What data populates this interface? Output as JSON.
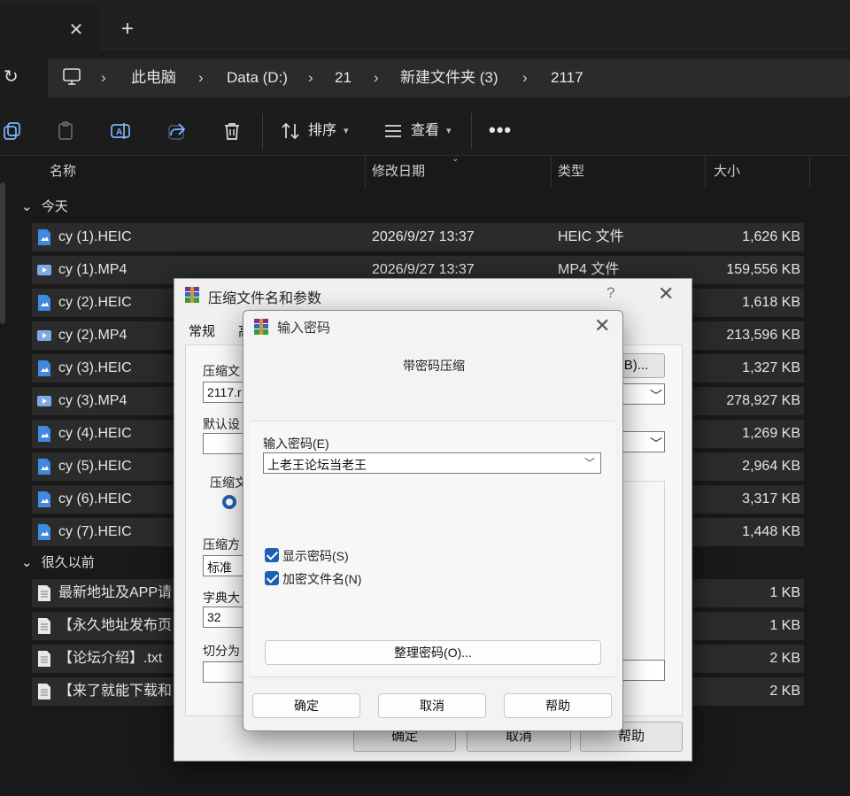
{
  "tabbar": {
    "close_icon": "close-icon",
    "new_tab_icon": "plus-icon",
    "close_glyph": "✕",
    "new_glyph": "+"
  },
  "address": {
    "crumbs": [
      "此电脑",
      "Data (D:)",
      "21",
      "新建文件夹 (3)",
      "2117"
    ],
    "separator": "›"
  },
  "toolbar": {
    "sort_label": "排序",
    "view_label": "查看",
    "more_glyph": "•••"
  },
  "columns": {
    "name": "名称",
    "modified": "修改日期",
    "type": "类型",
    "size": "大小"
  },
  "groups": {
    "today": "今天",
    "long_ago": "很久以前"
  },
  "group_chevron": "⌄",
  "files_today": [
    {
      "name": "cy (1).HEIC",
      "date": "2026/9/27 13:37",
      "type": "HEIC 文件",
      "size": "1,626 KB",
      "kind": "image"
    },
    {
      "name": "cy (1).MP4",
      "date": "2026/9/27 13:37",
      "type": "MP4 文件",
      "size": "159,556 KB",
      "kind": "video"
    },
    {
      "name": "cy (2).HEIC",
      "date": "",
      "type": "",
      "size": "1,618 KB",
      "kind": "image"
    },
    {
      "name": "cy (2).MP4",
      "date": "",
      "type": "",
      "size": "213,596 KB",
      "kind": "video"
    },
    {
      "name": "cy (3).HEIC",
      "date": "",
      "type": "",
      "size": "1,327 KB",
      "kind": "image"
    },
    {
      "name": "cy (3).MP4",
      "date": "",
      "type": "",
      "size": "278,927 KB",
      "kind": "video"
    },
    {
      "name": "cy (4).HEIC",
      "date": "",
      "type": "",
      "size": "1,269 KB",
      "kind": "image"
    },
    {
      "name": "cy (5).HEIC",
      "date": "",
      "type": "",
      "size": "2,964 KB",
      "kind": "image"
    },
    {
      "name": "cy (6).HEIC",
      "date": "",
      "type": "",
      "size": "3,317 KB",
      "kind": "image"
    },
    {
      "name": "cy (7).HEIC",
      "date": "",
      "type": "",
      "size": "1,448 KB",
      "kind": "image"
    }
  ],
  "files_old": [
    {
      "name": "最新地址及APP请",
      "size": "1 KB",
      "kind": "text"
    },
    {
      "name": "【永久地址发布页",
      "size": "1 KB",
      "kind": "text"
    },
    {
      "name": "【论坛介绍】.txt",
      "size": "2 KB",
      "kind": "text"
    },
    {
      "name": "【来了就能下载和",
      "size": "2 KB",
      "kind": "text"
    }
  ],
  "archive_dialog": {
    "title": "压缩文件名和参数",
    "help_glyph": "?",
    "close_glyph": "✕",
    "tab_general": "常规",
    "tab_partial": "高",
    "label_archive_name": "压缩文",
    "archive_name_value": "2117.r",
    "browse_button": "(B)...",
    "label_default": "默认设",
    "label_format": "压缩文",
    "label_method": "压缩方",
    "method_value": "标准",
    "label_dict": "字典大",
    "dict_value": "32",
    "label_split": "切分为",
    "ok": "确定",
    "cancel": "取消",
    "help": "帮助"
  },
  "password_dialog": {
    "title": "输入密码",
    "close_glyph": "✕",
    "heading": "带密码压缩",
    "label": "输入密码(E)",
    "value": "上老王论坛当老王",
    "caret_glyph": "﹀",
    "show_password": "显示密码(S)",
    "encrypt_names": "加密文件名(N)",
    "organize": "整理密码(O)...",
    "ok": "确定",
    "cancel": "取消",
    "help": "帮助"
  }
}
